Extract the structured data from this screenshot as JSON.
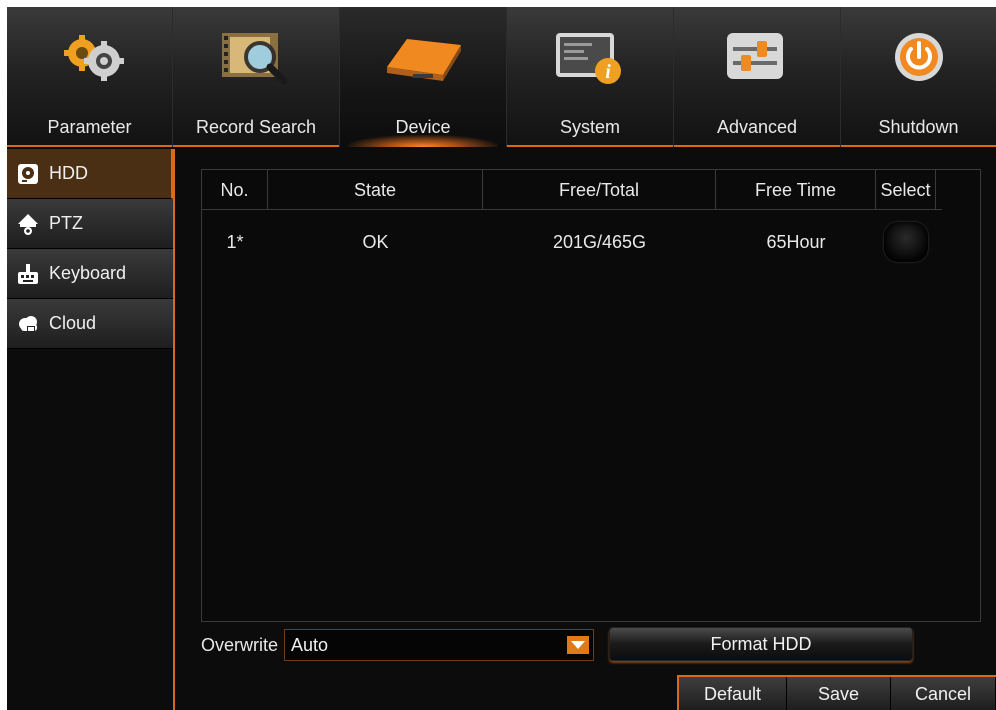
{
  "topnav": {
    "tabs": [
      {
        "label": "Parameter",
        "icon": "gears-icon"
      },
      {
        "label": "Record Search",
        "icon": "film-search-icon"
      },
      {
        "label": "Device",
        "icon": "hdd-device-icon"
      },
      {
        "label": "System",
        "icon": "system-info-icon"
      },
      {
        "label": "Advanced",
        "icon": "sliders-icon"
      },
      {
        "label": "Shutdown",
        "icon": "power-icon"
      }
    ],
    "active": "Device"
  },
  "sidebar": {
    "items": [
      {
        "label": "HDD",
        "icon": "hdd-icon"
      },
      {
        "label": "PTZ",
        "icon": "ptz-camera-icon"
      },
      {
        "label": "Keyboard",
        "icon": "keyboard-icon"
      },
      {
        "label": "Cloud",
        "icon": "cloud-icon"
      }
    ],
    "active": "HDD"
  },
  "hdd_table": {
    "headers": [
      "No.",
      "State",
      "Free/Total",
      "Free Time",
      "Select"
    ],
    "rows": [
      {
        "no": "1*",
        "state": "OK",
        "free_total": "201G/465G",
        "free_time": "65Hour"
      }
    ]
  },
  "overwrite": {
    "label": "Overwrite",
    "value": "Auto"
  },
  "format_button": "Format HDD",
  "buttons": {
    "default": "Default",
    "save": "Save",
    "cancel": "Cancel"
  },
  "colors": {
    "accent": "#d86a1a",
    "background": "#0c0c0c",
    "text": "#e8e8e8"
  }
}
